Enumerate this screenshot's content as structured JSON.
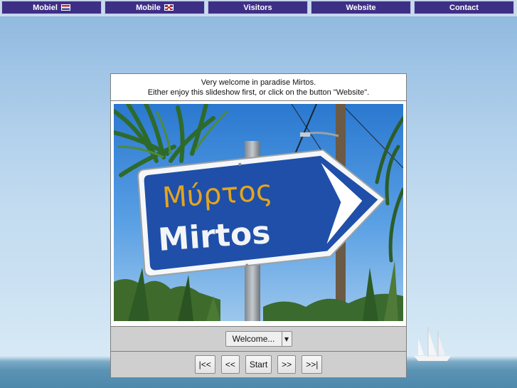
{
  "nav": {
    "items": [
      {
        "label": "Mobiel",
        "flag": "flag-nl"
      },
      {
        "label": "Mobile",
        "flag": "flag-uk"
      },
      {
        "label": "Visitors",
        "flag": ""
      },
      {
        "label": "Website",
        "flag": ""
      },
      {
        "label": "Contact",
        "flag": ""
      }
    ]
  },
  "welcome": {
    "line1": "Very welcome in paradise Mirtos.",
    "line2": "Either enjoy this slideshow first, or click on the button \"Website\"."
  },
  "photo": {
    "sign_greek": "Μύρτος",
    "sign_latin": "Mirtos"
  },
  "slideshow": {
    "selected": "Welcome...",
    "buttons": {
      "first": "|<<",
      "prev": "<<",
      "start": "Start",
      "next": ">>",
      "last": ">>|"
    }
  },
  "colors": {
    "nav_bg": "#3e2f86",
    "sign_blue": "#1f4fa8",
    "sign_yellow": "#e3a51f"
  }
}
